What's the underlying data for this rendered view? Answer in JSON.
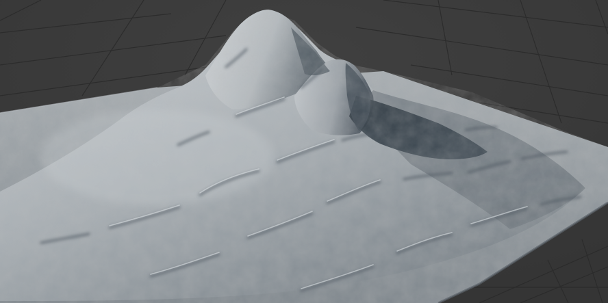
{
  "viewport": {
    "label": "",
    "background_color": "#3a3a3a",
    "grid_color": "#2b2b2b",
    "ground_color": "#8f969b",
    "terrain_light_color": "#c6ccd0",
    "terrain_mid_color": "#8f989e",
    "terrain_dark_color": "#4a5560",
    "shadow_color": "#27323b"
  },
  "scene": {
    "object": "terrain-heightmap",
    "features": [
      "mountain-peak",
      "secondary-peak",
      "cast-shadow",
      "erosion-ridges",
      "ground-plane",
      "floor-grid"
    ]
  }
}
